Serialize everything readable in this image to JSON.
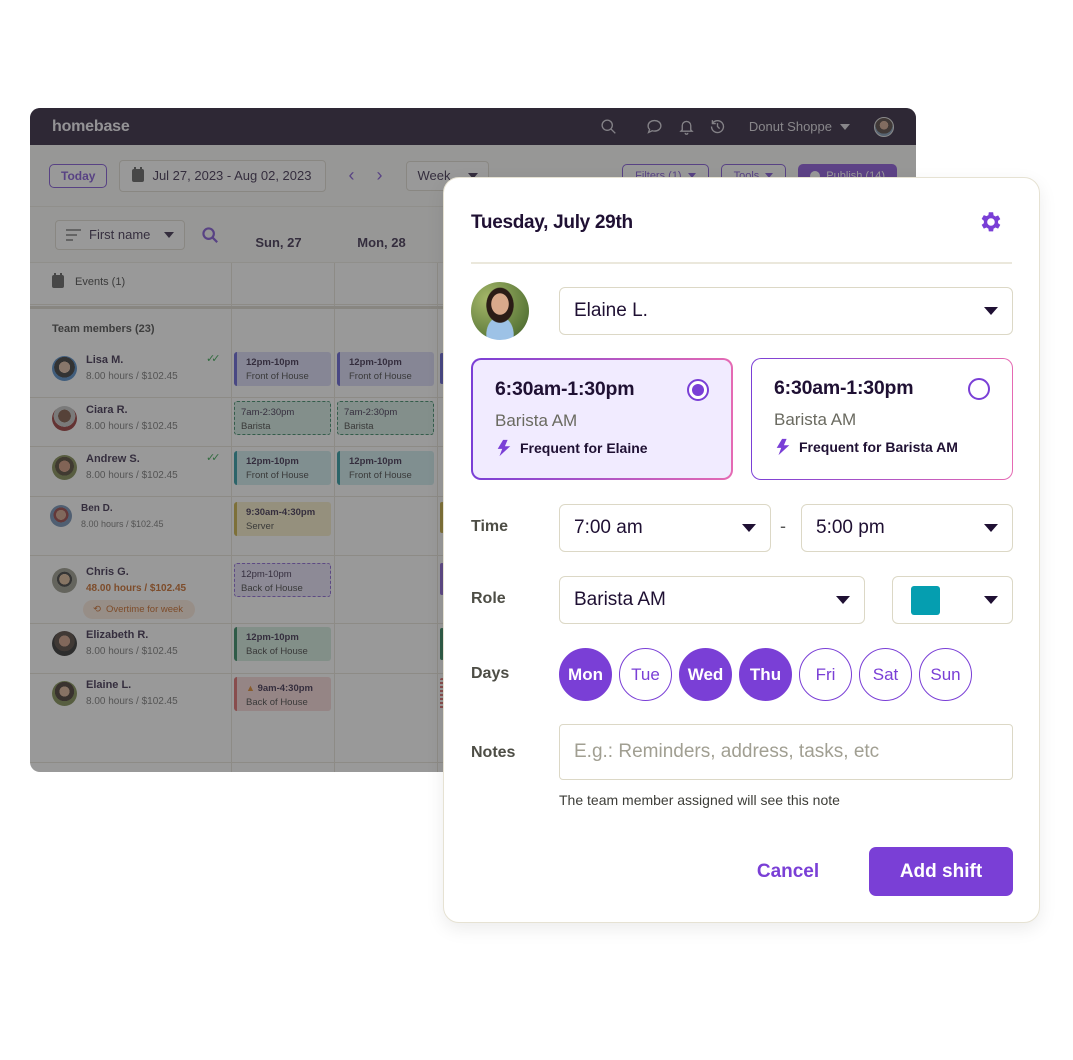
{
  "app": {
    "logo": "homebase",
    "store_name": "Donut Shoppe",
    "icons": [
      "search-icon",
      "chat-icon",
      "bell-icon",
      "history-icon"
    ]
  },
  "toolbar": {
    "today_label": "Today",
    "date_range": "Jul 27, 2023 - Aug 02, 2023",
    "prev_icon": "‹",
    "next_icon": "›",
    "view_select": "Week",
    "filters_label": "Filters (1)",
    "tools_label": "Tools",
    "publish_label": "Publish (14)"
  },
  "grid": {
    "sort_select": "First name",
    "days": [
      "Sun, 27",
      "Mon, 28"
    ],
    "events_label": "Events (1)",
    "team_label": "Team members (23)",
    "members": [
      {
        "name": "Lisa M.",
        "hours": "8.00 hours / $102.45",
        "confirmed": true,
        "shifts": [
          {
            "time": "12pm-10pm",
            "role": "Front of House",
            "style": "foh"
          },
          {
            "time": "12pm-10pm",
            "role": "Front of House",
            "style": "foh"
          }
        ]
      },
      {
        "name": "Ciara R.",
        "hours": "8.00 hours / $102.45",
        "confirmed": false,
        "shifts": [
          {
            "time": "7am-2:30pm",
            "role": "Barista",
            "style": "bar"
          },
          {
            "time": "7am-2:30pm",
            "role": "Barista",
            "style": "bar"
          }
        ]
      },
      {
        "name": "Andrew S.",
        "hours": "8.00 hours / $102.45",
        "confirmed": true,
        "shifts": [
          {
            "time": "12pm-10pm",
            "role": "Front of House",
            "style": "teal"
          },
          {
            "time": "12pm-10pm",
            "role": "Front of House",
            "style": "teal"
          }
        ]
      },
      {
        "name": "Ben D.",
        "hours": "8.00 hours / $102.45",
        "confirmed": false,
        "shifts": [
          {
            "time": "9:30am-4:30pm",
            "role": "Server",
            "style": "srv"
          }
        ]
      },
      {
        "name": "Chris G.",
        "hours": "48.00 hours / $102.45",
        "confirmed": false,
        "overtime": "Overtime for week",
        "shifts": [
          {
            "time": "12pm-10pm",
            "role": "Back of House",
            "style": "boh-d"
          }
        ]
      },
      {
        "name": "Elizabeth R.",
        "hours": "8.00 hours / $102.45",
        "confirmed": false,
        "shifts": [
          {
            "time": "12pm-10pm",
            "role": "Back of House",
            "style": "boh"
          }
        ]
      },
      {
        "name": "Elaine L.",
        "hours": "8.00 hours / $102.45",
        "confirmed": false,
        "shifts": [
          {
            "time": "9am-4:30pm",
            "role": "Back of House",
            "style": "red",
            "warning": true
          }
        ]
      }
    ]
  },
  "modal": {
    "title": "Tuesday, July 29th",
    "employee": "Elaine L.",
    "suggestions": [
      {
        "time": "6:30am-1:30pm",
        "role": "Barista AM",
        "note": "Frequent for Elaine",
        "selected": true
      },
      {
        "time": "6:30am-1:30pm",
        "role": "Barista AM",
        "note": "Frequent for Barista AM",
        "selected": false
      }
    ],
    "time_label": "Time",
    "start_time": "7:00 am",
    "time_separator": "-",
    "end_time": "5:00 pm",
    "role_label": "Role",
    "role": "Barista AM",
    "role_color": "#059eb0",
    "days_label": "Days",
    "days": [
      {
        "label": "Mon",
        "selected": true
      },
      {
        "label": "Tue",
        "selected": false
      },
      {
        "label": "Wed",
        "selected": true
      },
      {
        "label": "Thu",
        "selected": true
      },
      {
        "label": "Fri",
        "selected": false
      },
      {
        "label": "Sat",
        "selected": false
      },
      {
        "label": "Sun",
        "selected": false
      }
    ],
    "notes_label": "Notes",
    "notes_value": "",
    "notes_placeholder": "E.g.: Reminders, address, tasks, etc",
    "notes_hint": "The team member assigned will see this note",
    "cancel_label": "Cancel",
    "submit_label": "Add shift"
  },
  "colors": {
    "brand": "#7a3fd6",
    "topbar": "#120622"
  }
}
